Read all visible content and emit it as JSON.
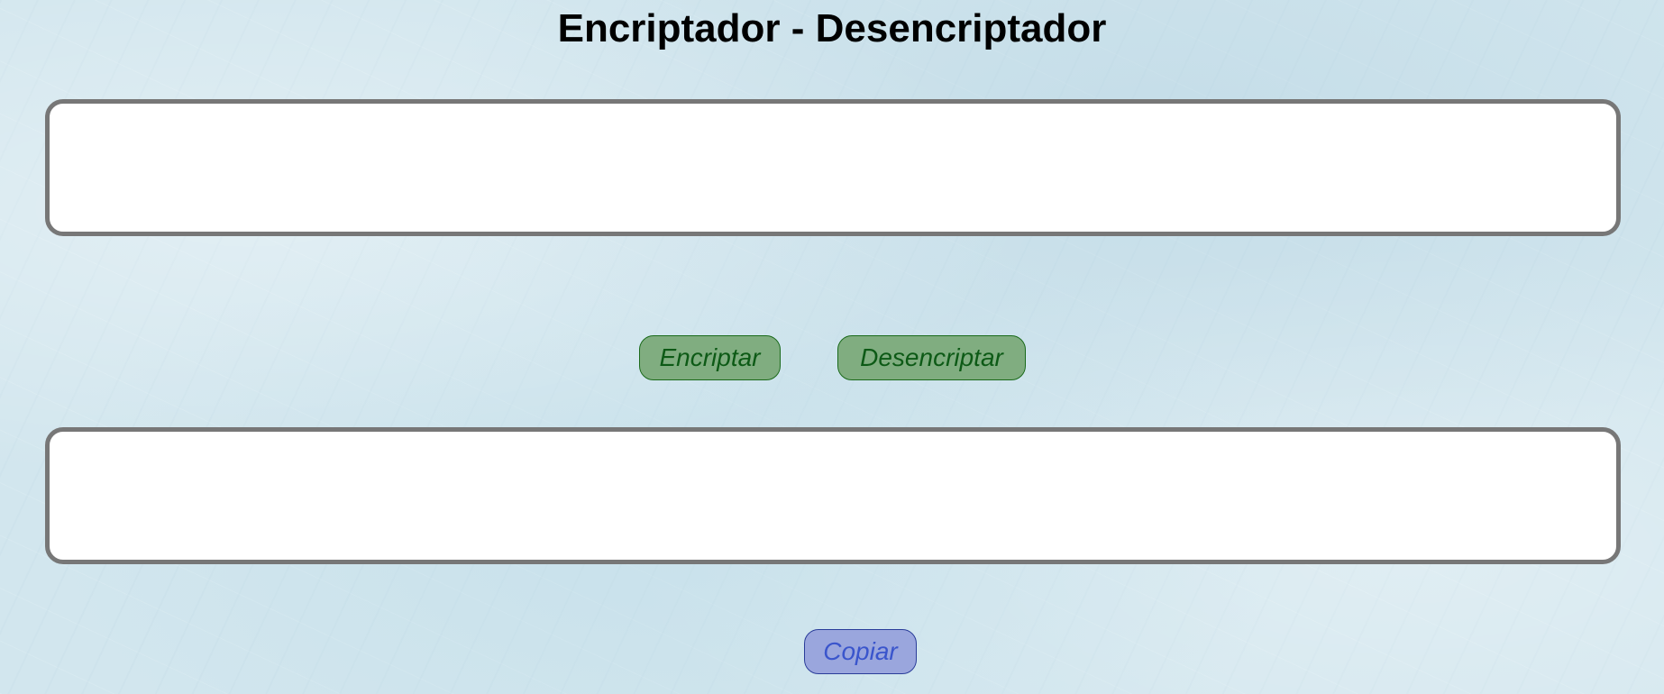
{
  "header": {
    "title": "Encriptador - Desencriptador"
  },
  "input": {
    "value": "",
    "placeholder": ""
  },
  "output": {
    "value": "",
    "placeholder": ""
  },
  "actions": {
    "encrypt_label": "Encriptar",
    "decrypt_label": "Desencriptar",
    "copy_label": "Copiar"
  },
  "colors": {
    "background": "#d2e6ee",
    "textbox_border": "#777777",
    "action_button_bg": "#80ad80",
    "action_button_text": "#0d5a16",
    "copy_button_bg": "#9aa6dd",
    "copy_button_text": "#3a55cc"
  }
}
